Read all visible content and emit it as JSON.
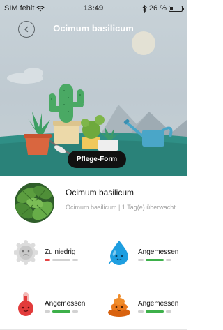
{
  "status_bar": {
    "carrier": "SIM fehlt",
    "time": "13:49",
    "battery": "26 %",
    "battery_level": 0.26
  },
  "header": {
    "title": "Ocimum basilicum"
  },
  "hero": {
    "care_button_label": "Pflege-Form"
  },
  "plant": {
    "name": "Ocimum basilicum",
    "meta": "Ocimum basilicum  |  1 Tag(e) überwacht"
  },
  "metrics": [
    {
      "icon": "sun-light-icon",
      "status": "Zu niedrig",
      "level": "low",
      "color": "#e64545"
    },
    {
      "icon": "water-drop-icon",
      "status": "Angemessen",
      "level": "ok",
      "color": "#3db04a"
    },
    {
      "icon": "thermometer-icon",
      "status": "Angemessen",
      "level": "ok",
      "color": "#3db04a"
    },
    {
      "icon": "fertilizer-icon",
      "status": "Angemessen",
      "level": "ok",
      "color": "#3db04a"
    }
  ],
  "colors": {
    "hero_ground": "#2f8f86",
    "ok": "#3db04a",
    "low": "#e64545"
  }
}
